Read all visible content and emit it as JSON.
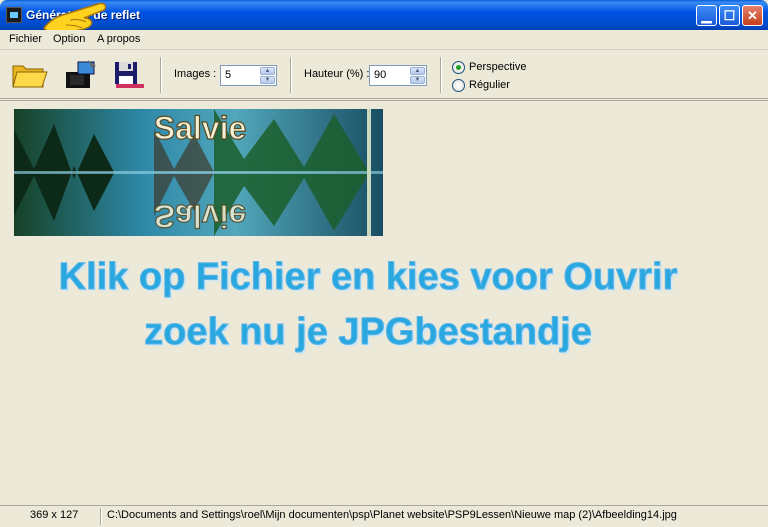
{
  "window": {
    "title": "Générateur de reflet",
    "controls": {
      "minimize": "minimize-icon",
      "maximize": "maximize-icon",
      "close": "close-icon"
    }
  },
  "menu": {
    "items": [
      {
        "label": "Fichier"
      },
      {
        "label": "Option"
      },
      {
        "label": "A propos"
      }
    ]
  },
  "toolbar": {
    "icons": [
      "open-folder-icon",
      "camera-icon",
      "save-icon"
    ],
    "images_label": "Images :",
    "images_value": "5",
    "hauteur_label": "Hauteur (%) :",
    "hauteur_value": "90",
    "radio_perspective": "Perspective",
    "radio_regulier": "Régulier",
    "selected_mode": "Perspective"
  },
  "preview": {
    "text": "Salvie",
    "reflected_text": "Salvie"
  },
  "instructions": {
    "line1": "Klik op Fichier en kies voor Ouvrir",
    "line2": "zoek nu je JPGbestandje"
  },
  "status": {
    "dimensions": "369 x 127",
    "path": "C:\\Documents and Settings\\roel\\Mijn documenten\\psp\\Planet website\\PSP9Lessen\\Nieuwe map (2)\\Afbeelding14.jpg"
  },
  "colors": {
    "titlebar": "#0054e3",
    "instruction_text": "#29a8e0",
    "window_bg": "#ece9d8"
  }
}
